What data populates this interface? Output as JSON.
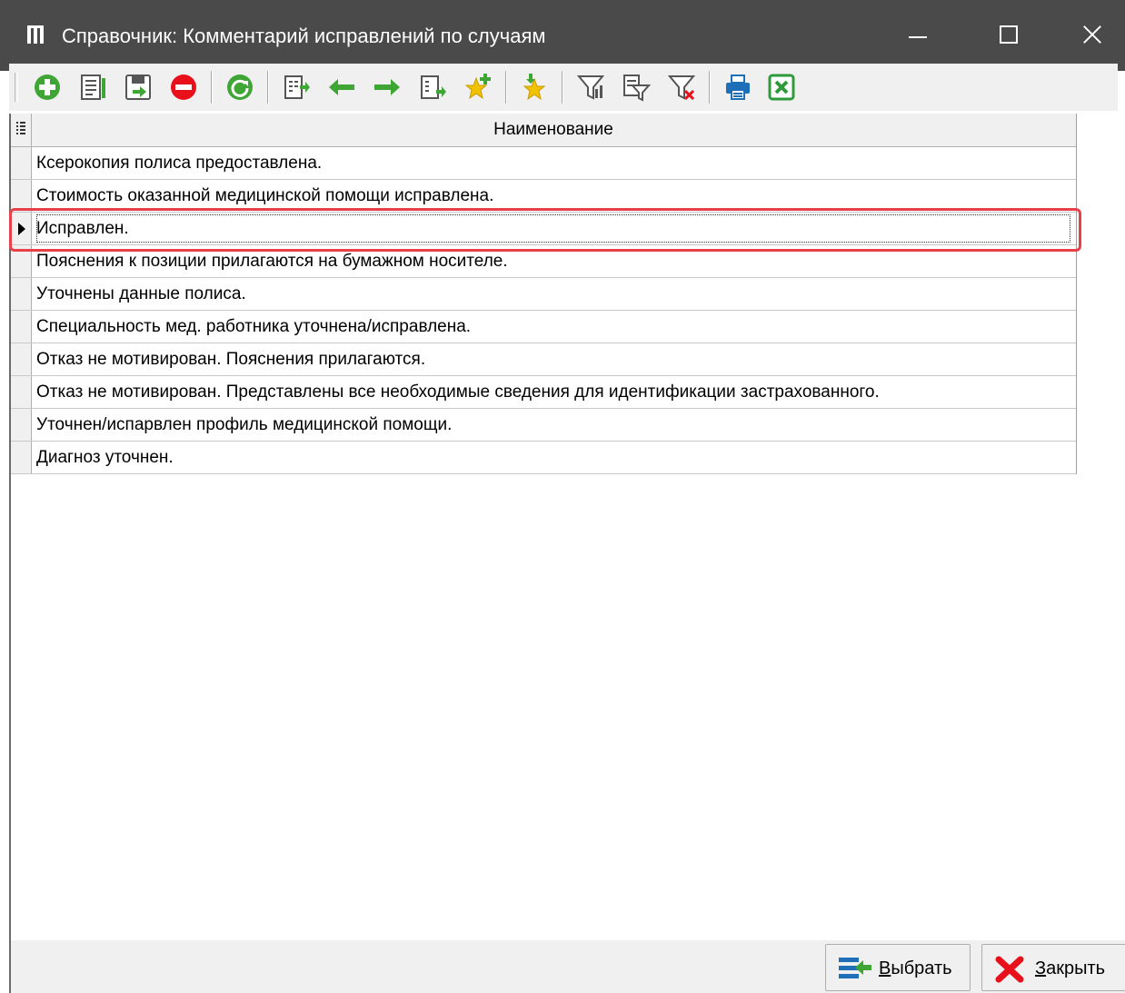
{
  "window": {
    "title": "Справочник: Комментарий исправлений по случаям",
    "title_bar_color": "#4a4a4a"
  },
  "toolbar": {
    "buttons": [
      {
        "name": "add-icon",
        "color": "#3fa535"
      },
      {
        "name": "edit-icon",
        "color": "#3fa535"
      },
      {
        "name": "save-icon",
        "color": "#3fa535"
      },
      {
        "name": "delete-icon",
        "color": "#e8101a"
      },
      {
        "name": "refresh-icon",
        "color": "#3fa535"
      },
      {
        "name": "move-to-icon",
        "color": "#3fa535"
      },
      {
        "name": "arrow-left-icon",
        "color": "#3fa535"
      },
      {
        "name": "arrow-right-icon",
        "color": "#3fa535"
      },
      {
        "name": "copy-to-icon",
        "color": "#3fa535"
      },
      {
        "name": "add-favorite-icon",
        "color": "#f2c200"
      },
      {
        "name": "favorites-icon",
        "color": "#f2c200"
      },
      {
        "name": "filter-icon",
        "color": "#555555"
      },
      {
        "name": "filter-edit-icon",
        "color": "#555555"
      },
      {
        "name": "filter-clear-icon",
        "color": "#e8101a"
      },
      {
        "name": "print-icon",
        "color": "#1e6fb8"
      },
      {
        "name": "excel-export-icon",
        "color": "#2e9a3a"
      }
    ]
  },
  "grid": {
    "column_header": "Наименование",
    "selected_index": 2,
    "rows": [
      "Ксерокопия полиса предоставлена.",
      "Стоимость оказанной медицинской помощи исправлена.",
      "Исправлен.",
      "Пояснения к позиции прилагаются на бумажном носителе.",
      "Уточнены данные полиса.",
      "Специальность мед. работника уточнена/исправлена.",
      "Отказ не мотивирован. Пояснения прилагаются.",
      "Отказ не мотивирован. Представлены все необходимые сведения для идентификации застрахованного.",
      "Уточнен/испарвлен профиль медицинской помощи.",
      "Диагноз уточнен."
    ],
    "highlight_color": "#e8404b"
  },
  "footer": {
    "select_label": {
      "accel": "В",
      "rest": "ыбрать"
    },
    "close_label": {
      "accel": "З",
      "rest": "акрыть"
    }
  }
}
